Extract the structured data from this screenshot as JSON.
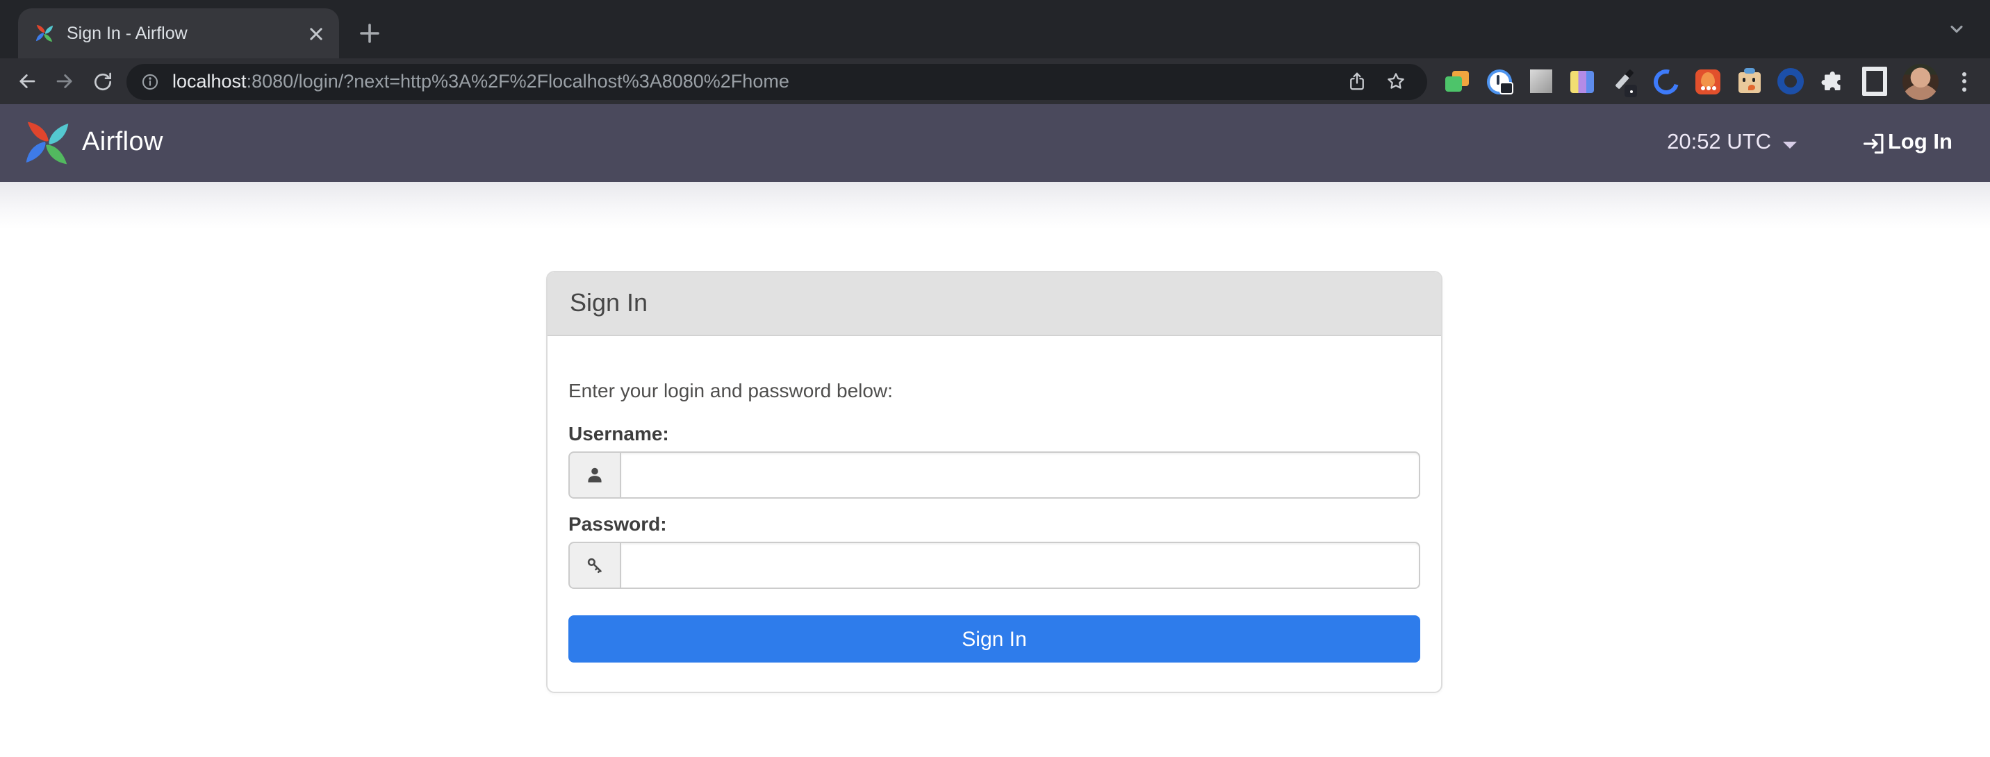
{
  "browser": {
    "tab": {
      "title": "Sign In - Airflow"
    },
    "toolbar": {
      "url_host": "localhost",
      "url_rest": ":8080/login/?next=http%3A%2F%2Flocalhost%3A8080%2Fhome",
      "extensions": [
        "folders",
        "screen-time-lock",
        "gray-swatch",
        "color-note-cards",
        "color-picker-pen",
        "blue-c-ring",
        "flame",
        "clipboard-buddy",
        "blue-ring",
        "extensions-puzzle",
        "side-panel"
      ]
    }
  },
  "navbar": {
    "brand": "Airflow",
    "clock": "20:52 UTC",
    "login_label": "Log In"
  },
  "signin": {
    "title": "Sign In",
    "instruction": "Enter your login and password below:",
    "username_label": "Username:",
    "username_value": "",
    "password_label": "Password:",
    "password_value": "",
    "submit_label": "Sign In"
  },
  "colors": {
    "navbar_bg": "#4A495C",
    "submit_blue": "#2E7CEB",
    "card_header_bg": "#E1E1E1",
    "logo_red": "#E0452D",
    "logo_teal": "#54C8D0",
    "logo_green": "#52B95F",
    "logo_blue": "#3E7BE8"
  }
}
